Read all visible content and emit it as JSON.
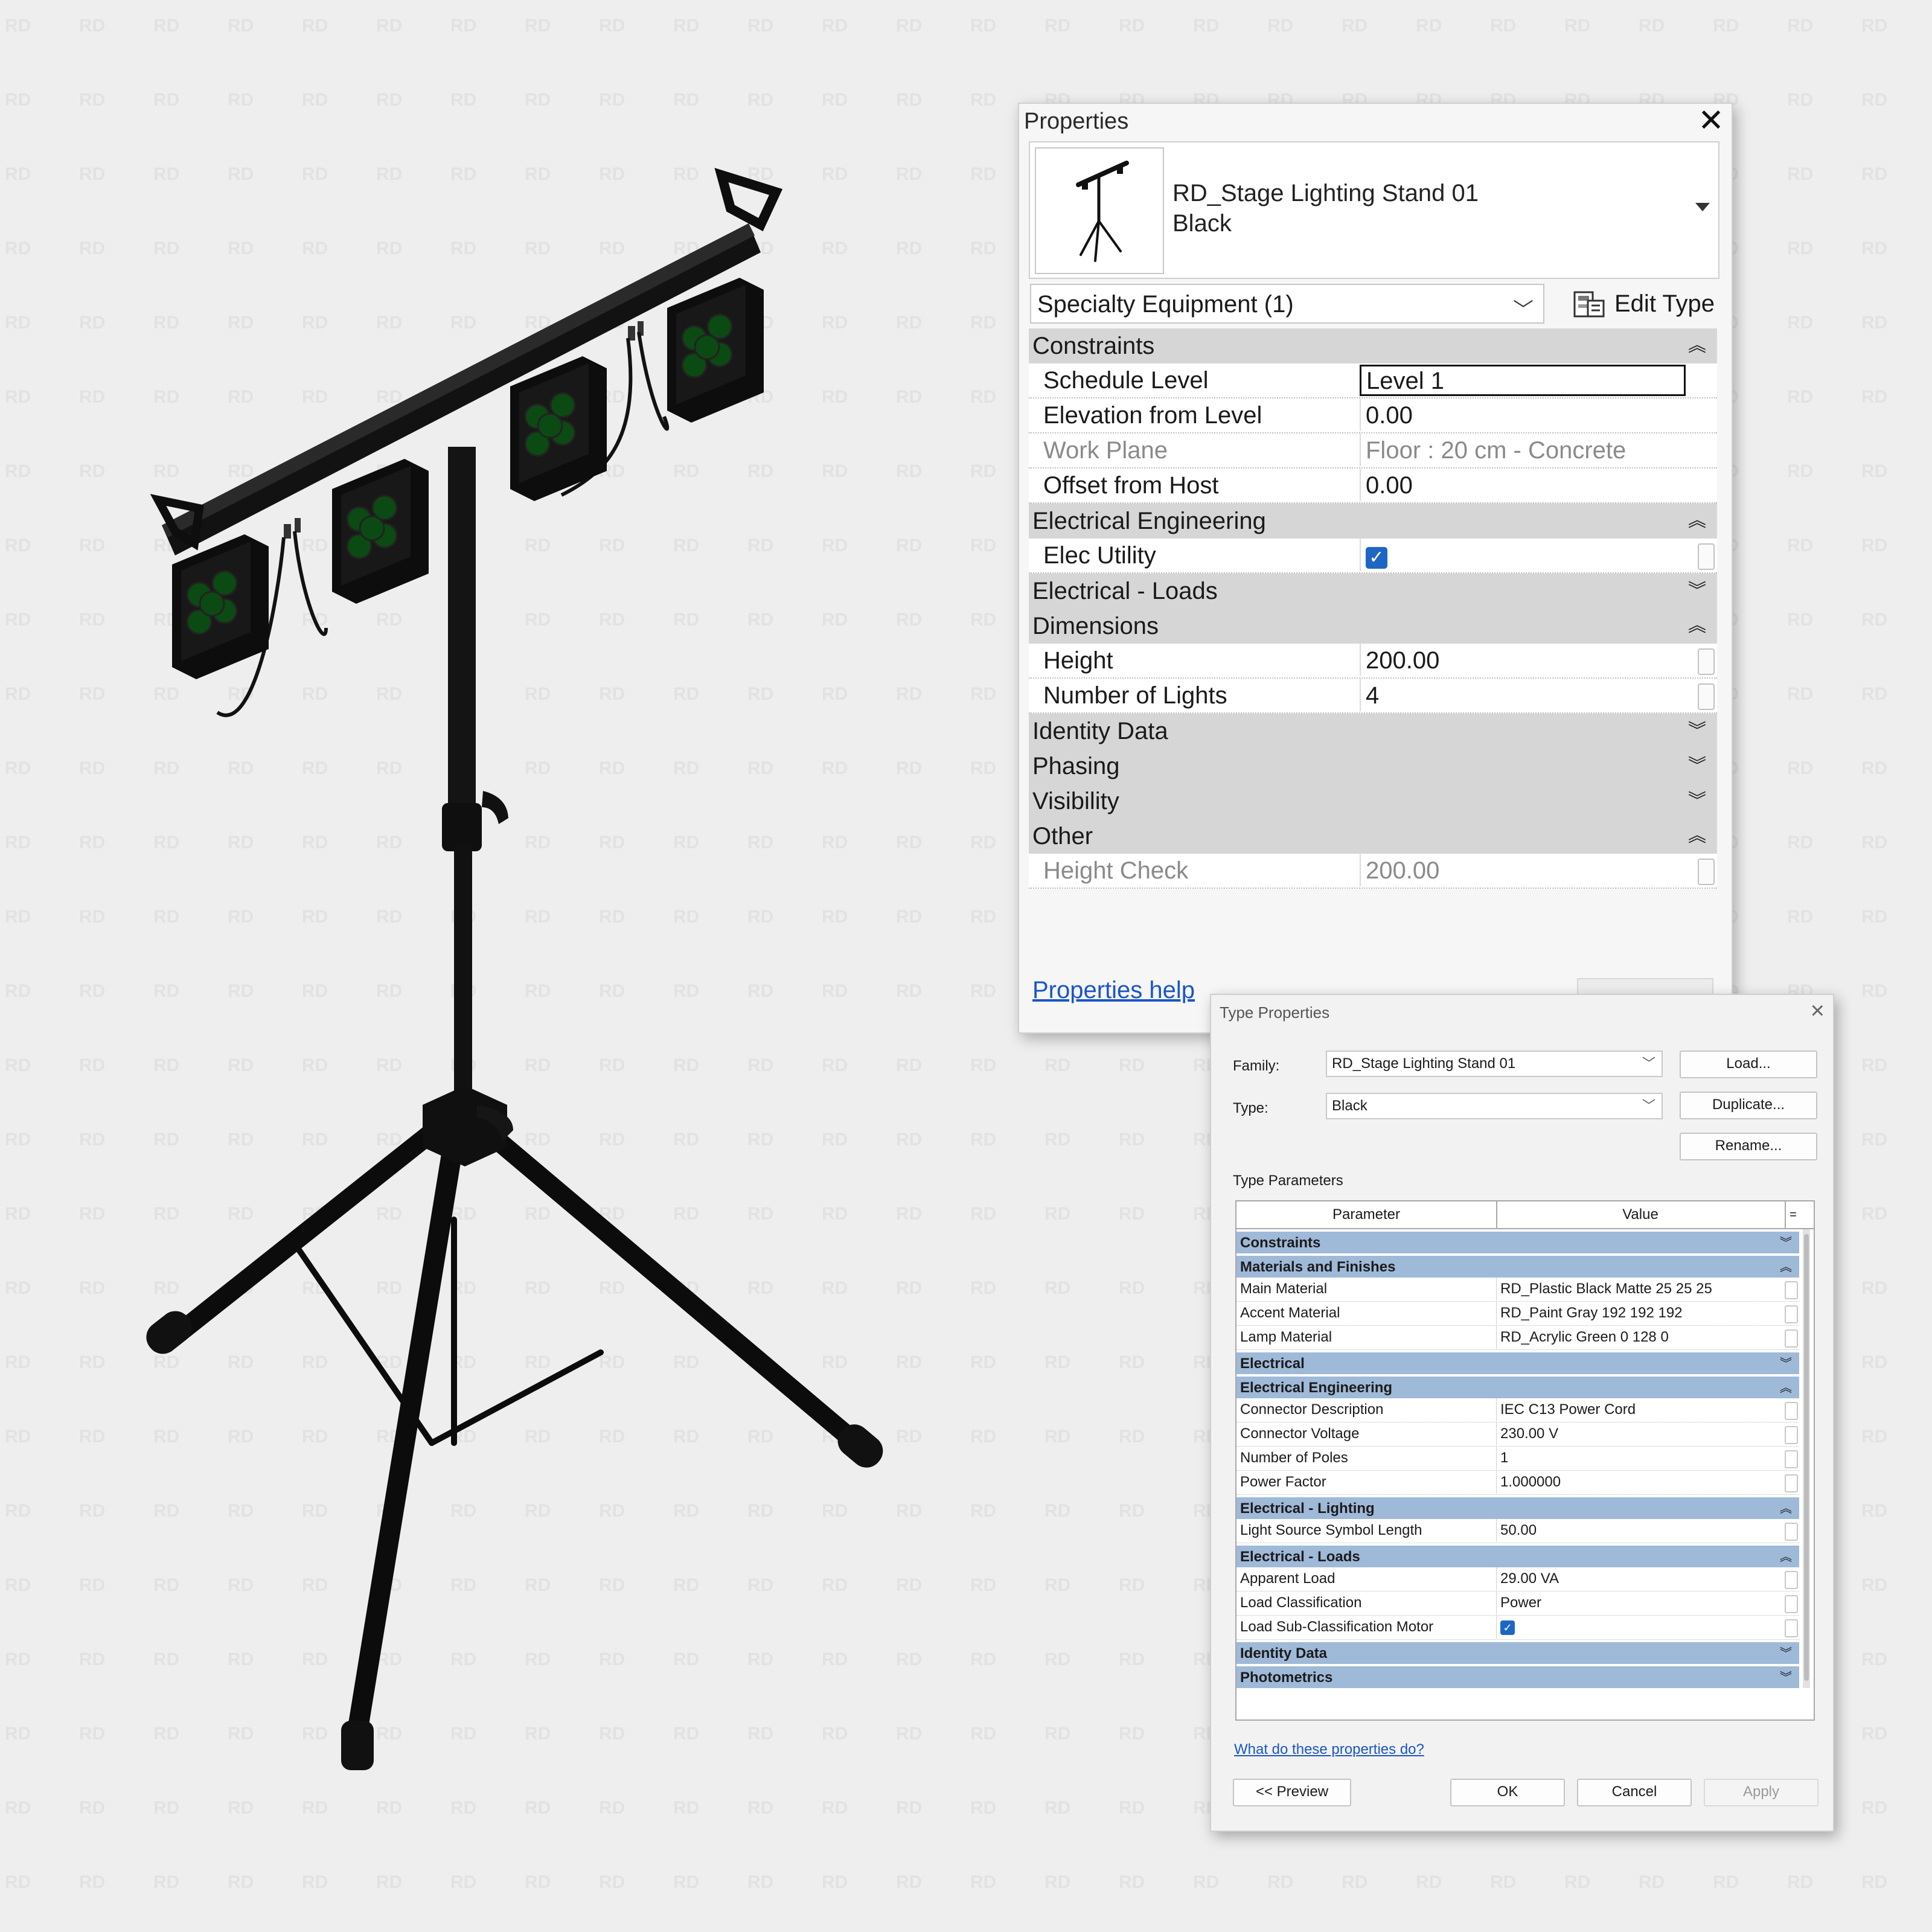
{
  "watermark": "RD",
  "properties": {
    "title": "Properties",
    "type_name": "RD_Stage Lighting Stand 01",
    "type_sub": "Black",
    "category": "Specialty Equipment (1)",
    "edit_type": "Edit Type",
    "groups": [
      {
        "name": "Constraints",
        "state": "expanded",
        "rows": [
          {
            "label": "Schedule Level",
            "value": "Level 1",
            "editing": true
          },
          {
            "label": "Elevation from Level",
            "value": "0.00"
          },
          {
            "label": "Work Plane",
            "value": "Floor : 20 cm - Concrete",
            "dim": true
          },
          {
            "label": "Offset from Host",
            "value": "0.00"
          }
        ]
      },
      {
        "name": "Electrical Engineering",
        "state": "expanded",
        "rows": [
          {
            "label": "Elec Utility",
            "checkbox": true
          }
        ]
      },
      {
        "name": "Electrical - Loads",
        "state": "collapsed",
        "rows": []
      },
      {
        "name": "Dimensions",
        "state": "expanded",
        "rows": [
          {
            "label": "Height",
            "value": "200.00"
          },
          {
            "label": "Number of Lights",
            "value": "4"
          }
        ]
      },
      {
        "name": "Identity Data",
        "state": "collapsed",
        "rows": []
      },
      {
        "name": "Phasing",
        "state": "collapsed",
        "rows": []
      },
      {
        "name": "Visibility",
        "state": "collapsed",
        "rows": []
      },
      {
        "name": "Other",
        "state": "expanded",
        "rows": [
          {
            "label": "Height Check",
            "value": "200.00",
            "dim": true
          }
        ]
      }
    ],
    "help_link": "Properties help"
  },
  "type_properties": {
    "title": "Type Properties",
    "family_label": "Family:",
    "family_value": "RD_Stage Lighting Stand 01",
    "type_label": "Type:",
    "type_value": "Black",
    "load_btn": "Load...",
    "duplicate_btn": "Duplicate...",
    "rename_btn": "Rename...",
    "params_label": "Type Parameters",
    "col_param": "Parameter",
    "col_value": "Value",
    "col_eq": "=",
    "groups": [
      {
        "name": "Constraints",
        "state": "collapsed",
        "rows": []
      },
      {
        "name": "Materials and Finishes",
        "state": "expanded",
        "rows": [
          {
            "label": "Main Material",
            "value": "RD_Plastic Black Matte 25 25 25"
          },
          {
            "label": "Accent Material",
            "value": "RD_Paint Gray 192 192 192"
          },
          {
            "label": "Lamp Material",
            "value": "RD_Acrylic Green 0 128 0"
          }
        ]
      },
      {
        "name": "Electrical",
        "state": "collapsed",
        "rows": []
      },
      {
        "name": "Electrical Engineering",
        "state": "expanded",
        "rows": [
          {
            "label": "Connector Description",
            "value": "IEC C13 Power Cord"
          },
          {
            "label": "Connector Voltage",
            "value": "230.00 V"
          },
          {
            "label": "Number of Poles",
            "value": "1"
          },
          {
            "label": "Power Factor",
            "value": "1.000000"
          }
        ]
      },
      {
        "name": "Electrical - Lighting",
        "state": "expanded",
        "rows": [
          {
            "label": "Light Source Symbol Length",
            "value": "50.00"
          }
        ]
      },
      {
        "name": "Electrical - Loads",
        "state": "expanded",
        "rows": [
          {
            "label": "Apparent Load",
            "value": "29.00 VA"
          },
          {
            "label": "Load Classification",
            "value": "Power"
          },
          {
            "label": "Load Sub-Classification Motor",
            "checkbox": true
          }
        ]
      },
      {
        "name": "Identity Data",
        "state": "collapsed",
        "rows": []
      },
      {
        "name": "Photometrics",
        "state": "collapsed",
        "rows": []
      }
    ],
    "help_link": "What do these properties do?",
    "preview_btn": "<< Preview",
    "ok_btn": "OK",
    "cancel_btn": "Cancel",
    "apply_btn": "Apply"
  },
  "colors": {
    "lamp_green": "#0b4a12",
    "checkbox_blue": "#1e66c4",
    "type_group_blue": "#9fb9d8",
    "link_blue": "#1a56c7"
  }
}
